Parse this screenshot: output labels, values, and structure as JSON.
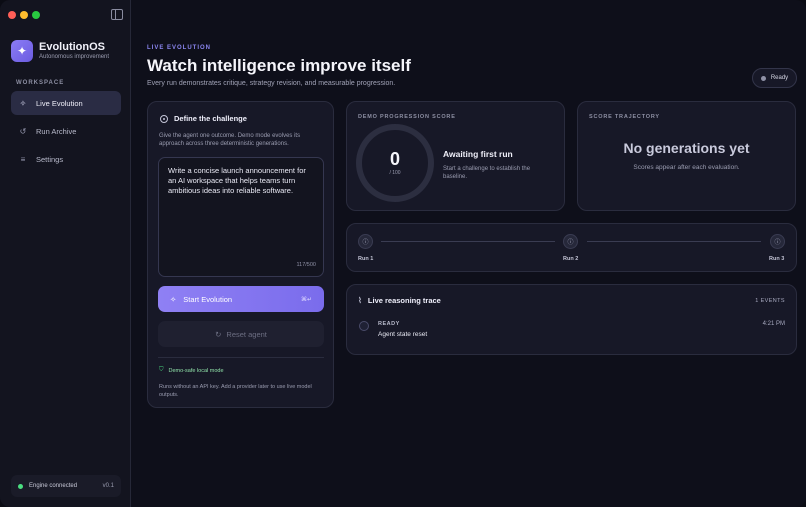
{
  "app": {
    "name": "EvolutionOS",
    "tagline": "Autonomous improvement"
  },
  "sidebar": {
    "section_label": "WORKSPACE",
    "items": [
      {
        "label": "Live Evolution",
        "icon": "sparkle-icon",
        "active": true
      },
      {
        "label": "Run Archive",
        "icon": "history-icon",
        "active": false
      },
      {
        "label": "Settings",
        "icon": "sliders-icon",
        "active": false
      }
    ],
    "engine_status": "Engine connected",
    "version": "v0.1"
  },
  "header": {
    "eyebrow": "LIVE EVOLUTION",
    "title": "Watch intelligence improve itself",
    "subtitle": "Every run demonstrates critique, strategy revision, and measurable progression.",
    "status": "Ready"
  },
  "challenge": {
    "title": "Define the challenge",
    "description": "Give the agent one outcome. Demo mode evolves its approach across three deterministic generations.",
    "prompt_value": "Write a concise launch announcement for an AI workspace that helps teams turn ambitious ideas into reliable software.",
    "char_count": "117/500",
    "start_label": "Start Evolution",
    "start_shortcut": "⌘↵",
    "reset_label": "Reset agent",
    "safe_mode_label": "Demo-safe local mode",
    "safe_mode_desc": "Runs without an API key. Add a provider later to use live model outputs."
  },
  "score": {
    "label": "DEMO PROGRESSION SCORE",
    "value": "0",
    "max": "/ 100",
    "status": "Awaiting first run",
    "hint": "Start a challenge to establish the baseline."
  },
  "trajectory": {
    "label": "SCORE TRAJECTORY",
    "title": "No generations yet",
    "subtitle": "Scores appear after each evaluation."
  },
  "runs": [
    {
      "label": "Run 1"
    },
    {
      "label": "Run 2"
    },
    {
      "label": "Run 3"
    }
  ],
  "trace": {
    "title": "Live reasoning trace",
    "count": "1 EVENTS",
    "events": [
      {
        "status": "READY",
        "text": "Agent state reset",
        "time": "4:21 PM"
      }
    ]
  },
  "colors": {
    "accent": "#8b7cf6",
    "success": "#4ade80",
    "background": "#0e0f1a",
    "card": "#171827"
  }
}
